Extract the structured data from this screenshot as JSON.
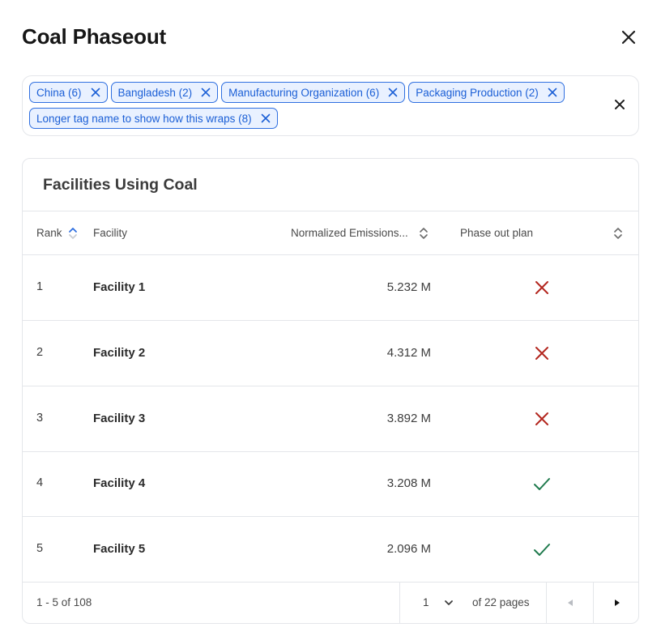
{
  "modal": {
    "title": "Coal Phaseout"
  },
  "tags": [
    {
      "label": "China (6)"
    },
    {
      "label": "Bangladesh (2)"
    },
    {
      "label": "Manufacturing Organization (6)"
    },
    {
      "label": "Packaging Production (2)"
    },
    {
      "label": "Longer tag name to show how this wraps (8)"
    }
  ],
  "table": {
    "title": "Facilities Using Coal",
    "columns": {
      "rank": "Rank",
      "facility": "Facility",
      "emissions": "Normalized Emissions...",
      "plan": "Phase out plan"
    },
    "sort": {
      "column": "rank",
      "direction": "asc"
    },
    "rows": [
      {
        "rank": "1",
        "facility": "Facility 1",
        "emissions": "5.232 M",
        "plan": false
      },
      {
        "rank": "2",
        "facility": "Facility 2",
        "emissions": "4.312 M",
        "plan": false
      },
      {
        "rank": "3",
        "facility": "Facility 3",
        "emissions": "3.892 M",
        "plan": false
      },
      {
        "rank": "4",
        "facility": "Facility 4",
        "emissions": "3.208 M",
        "plan": true
      },
      {
        "rank": "5",
        "facility": "Facility 5",
        "emissions": "2.096 M",
        "plan": true
      }
    ]
  },
  "pagination": {
    "range": "1 - 5 of 108",
    "current_page": "1",
    "of_pages": "of 22 pages"
  },
  "icons": {
    "no_plan": "x-mark-icon",
    "has_plan": "checkmark-icon"
  },
  "colors": {
    "tag_border": "#2f6fe0",
    "tag_bg": "#e9f1ff",
    "tag_text": "#1b5fd6",
    "no_plan": "#b3261e",
    "has_plan": "#1f7a4d"
  }
}
